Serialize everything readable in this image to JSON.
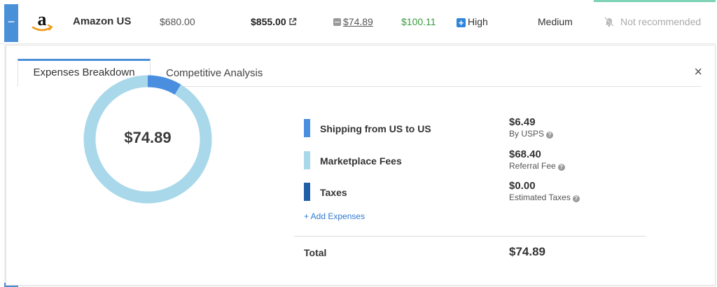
{
  "row": {
    "toggle": "−",
    "store_name": "Amazon US",
    "cost": "$680.00",
    "price": "$855.00",
    "expenses": "$74.89",
    "profit": "$100.11",
    "demand": "High",
    "competition": "Medium",
    "recommendation": "Not recommended"
  },
  "tabs": [
    {
      "label": "Expenses Breakdown",
      "active": true
    },
    {
      "label": "Competitive Analysis",
      "active": false
    }
  ],
  "close_label": "×",
  "breakdown": {
    "total": "$74.89",
    "items": [
      {
        "label": "Shipping from US to US",
        "amount": "$6.49",
        "sub": "By USPS",
        "value": 6.49,
        "color": "#4a8ee0"
      },
      {
        "label": "Marketplace Fees",
        "amount": "$68.40",
        "sub": "Referral Fee",
        "value": 68.4,
        "color": "#a8d8ea"
      },
      {
        "label": "Taxes",
        "amount": "$0.00",
        "sub": "Estimated Taxes",
        "value": 0.0,
        "color": "#1f5fa8"
      }
    ],
    "add_label": "+ Add Expenses",
    "total_label": "Total",
    "total_value": "$74.89"
  },
  "icons": {
    "logo": "amazon-logo",
    "external": "external-link-icon",
    "notification_off": "bell-off-icon",
    "help": "help-circle-icon"
  }
}
